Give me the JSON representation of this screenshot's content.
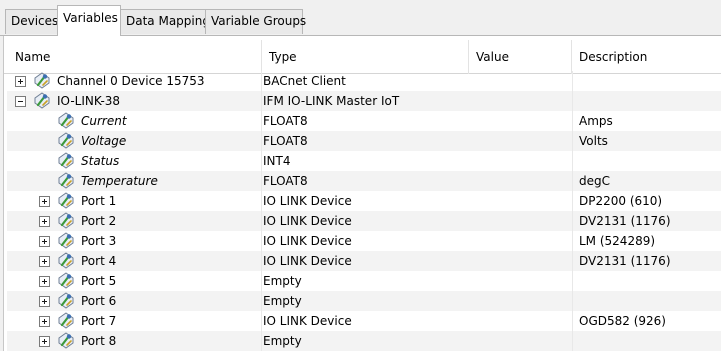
{
  "tabs": [
    {
      "label": "Devices",
      "active": false
    },
    {
      "label": "Variables",
      "active": true
    },
    {
      "label": "Data Mapping",
      "active": false
    },
    {
      "label": "Variable Groups",
      "active": false
    }
  ],
  "columns": [
    "Name",
    "Type",
    "Value",
    "Description"
  ],
  "rows": [
    {
      "name": "Channel 0 Device 15753",
      "type": "BACnet Client",
      "value": "",
      "description": "",
      "level": 0,
      "expander": "plus",
      "italic": false
    },
    {
      "name": "IO-LINK-38",
      "type": "IFM IO-LINK Master IoT",
      "value": "",
      "description": "",
      "level": 0,
      "expander": "minus",
      "italic": false
    },
    {
      "name": "Current",
      "type": "FLOAT8",
      "value": "",
      "description": "Amps",
      "level": 1,
      "expander": "none",
      "italic": true
    },
    {
      "name": "Voltage",
      "type": "FLOAT8",
      "value": "",
      "description": "Volts",
      "level": 1,
      "expander": "none",
      "italic": true
    },
    {
      "name": "Status",
      "type": "INT4",
      "value": "",
      "description": "",
      "level": 1,
      "expander": "none",
      "italic": true
    },
    {
      "name": "Temperature",
      "type": "FLOAT8",
      "value": "",
      "description": "degC",
      "level": 1,
      "expander": "none",
      "italic": true
    },
    {
      "name": "Port 1",
      "type": "IO LINK Device",
      "value": "",
      "description": "DP2200 (610)",
      "level": 1,
      "expander": "plus",
      "italic": false
    },
    {
      "name": "Port 2",
      "type": "IO LINK Device",
      "value": "",
      "description": "DV2131 (1176)",
      "level": 1,
      "expander": "plus",
      "italic": false
    },
    {
      "name": "Port 3",
      "type": "IO LINK Device",
      "value": "",
      "description": "LM (524289)",
      "level": 1,
      "expander": "plus",
      "italic": false
    },
    {
      "name": "Port 4",
      "type": "IO LINK Device",
      "value": "",
      "description": "DV2131 (1176)",
      "level": 1,
      "expander": "plus",
      "italic": false
    },
    {
      "name": "Port 5",
      "type": "Empty",
      "value": "",
      "description": "",
      "level": 1,
      "expander": "plus",
      "italic": false
    },
    {
      "name": "Port 6",
      "type": "Empty",
      "value": "",
      "description": "",
      "level": 1,
      "expander": "plus",
      "italic": false
    },
    {
      "name": "Port 7",
      "type": "IO LINK Device",
      "value": "",
      "description": "OGD582 (926)",
      "level": 1,
      "expander": "plus",
      "italic": false
    },
    {
      "name": "Port 8",
      "type": "Empty",
      "value": "",
      "description": "",
      "level": 1,
      "expander": "plus",
      "italic": false
    }
  ],
  "icons": {
    "tree_node": "variable-tag-icon",
    "expand": "plus-icon",
    "collapse": "minus-icon"
  },
  "colors": {
    "row_alt": "#f3f3f3",
    "icon_green": "#3c9a3c",
    "icon_blue": "#3b6fb0"
  }
}
